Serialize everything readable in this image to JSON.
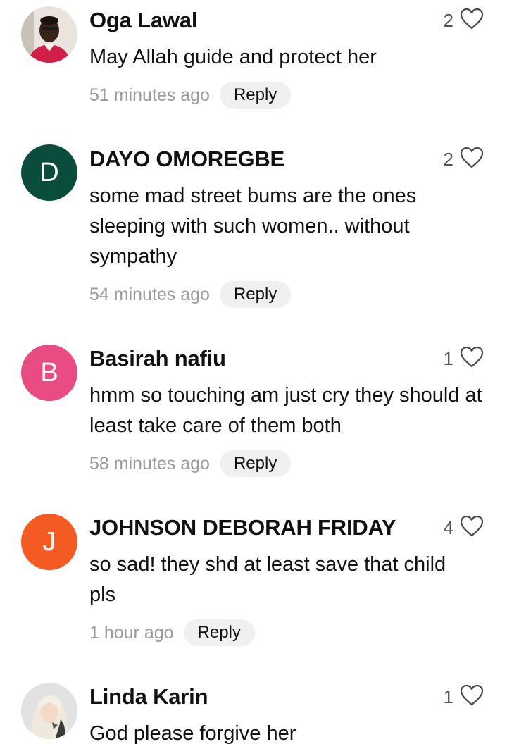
{
  "comments": [
    {
      "author": "Oga Lawal",
      "likes": "2",
      "text": "May Allah guide and protect her",
      "time": "51 minutes ago",
      "reply": "Reply",
      "avatar": {
        "type": "photo",
        "icon": "person-photo",
        "color": "#c02040"
      }
    },
    {
      "author": "DAYO OMOREGBE",
      "likes": "2",
      "text": "some mad street bums are the ones sleeping with such women.. without sympathy",
      "time": "54 minutes ago",
      "reply": "Reply",
      "avatar": {
        "type": "letter",
        "letter": "D",
        "color": "#0a4d3c"
      }
    },
    {
      "author": "Basirah nafiu",
      "likes": "1",
      "text": "hmm so touching am just cry they should at least take care of them both",
      "time": "58 minutes ago",
      "reply": "Reply",
      "avatar": {
        "type": "letter",
        "letter": "B",
        "color": "#e84c82"
      }
    },
    {
      "author": "JOHNSON DEBORAH FRIDAY",
      "likes": "4",
      "text": "so sad! they shd at least save that child pls",
      "time": "1 hour ago",
      "reply": "Reply",
      "avatar": {
        "type": "letter",
        "letter": "J",
        "color": "#f45b23"
      }
    },
    {
      "author": "Linda Karin",
      "likes": "1",
      "text": "God please forgive her",
      "time": "",
      "reply": "",
      "avatar": {
        "type": "photo",
        "icon": "person-photo",
        "color": "#d8d8d8"
      }
    }
  ]
}
